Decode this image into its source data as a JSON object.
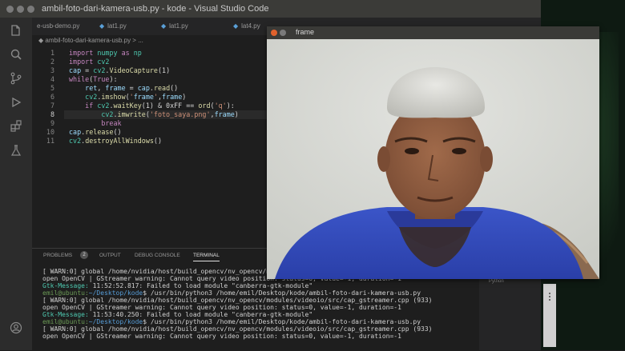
{
  "window": {
    "title": "ambil-foto-dari-kamera-usb.py - kode - Visual Studio Code"
  },
  "tabs": [
    {
      "label": "e-usb-demo.py"
    },
    {
      "label": "lat1.py"
    },
    {
      "label": "lat1.py"
    },
    {
      "label": "lat4.py"
    }
  ],
  "breadcrumb": "◆ ambil-foto-dari-kamera-usb.py > ...",
  "code": {
    "current_line": 8,
    "lines": [
      {
        "n": "1",
        "text": "import numpy as np"
      },
      {
        "n": "2",
        "text": "import cv2"
      },
      {
        "n": "3",
        "text": "cap = cv2.VideoCapture(1)"
      },
      {
        "n": "4",
        "text": "while(True):"
      },
      {
        "n": "5",
        "text": "    ret, frame = cap.read()"
      },
      {
        "n": "6",
        "text": "    cv2.imshow('frame',frame)"
      },
      {
        "n": "7",
        "text": "    if cv2.waitKey(1) & 0xFF == ord('q'):"
      },
      {
        "n": "8",
        "text": "        cv2.imwrite('foto_saya.png',frame)"
      },
      {
        "n": "9",
        "text": "        break"
      },
      {
        "n": "10",
        "text": "cap.release()"
      },
      {
        "n": "11",
        "text": "cv2.destroyAllWindows()"
      }
    ]
  },
  "panel": {
    "tabs": [
      {
        "label": "PROBLEMS"
      },
      {
        "label": "OUTPUT"
      },
      {
        "label": "DEBUG CONSOLE"
      },
      {
        "label": "TERMINAL"
      }
    ],
    "problems_count": "2",
    "terminal": [
      {
        "text": "[ WARN:0] global /home/nvidia/host/build_opencv/nv_opencv/modules/videoio/src/cap_gstreamer.cpp (933)",
        "color": "#d0d0d0"
      },
      {
        "text": "open OpenCV | GStreamer warning: Cannot query video position: status=0, value=-1, duration=-1",
        "color": "#d0d0d0"
      },
      {
        "text": "Gtk-Message: 11:52:52.817: Failed to load module \"canberra-gtk-module\"",
        "color": "#d0d0d0"
      },
      {
        "text": "emil@ubuntu:~/Desktop/kode$ /usr/bin/python3 /home/emil/Desktop/kode/ambil-foto-dari-kamera-usb.py",
        "color": "#d0d0d0"
      },
      {
        "text": "[ WARN:0] global /home/nvidia/host/build_opencv/nv_opencv/modules/videoio/src/cap_gstreamer.cpp (933)",
        "color": "#d0d0d0"
      },
      {
        "text": "open OpenCV | GStreamer warning: Cannot query video position: status=0, value=-1, duration=-1",
        "color": "#d0d0d0"
      },
      {
        "text": "Gtk-Message: 11:53:40.250: Failed to load module \"canberra-gtk-module\"",
        "color": "#d0d0d0"
      },
      {
        "text": "emil@ubuntu:~/Desktop/kode$ /usr/bin/python3 /home/emil/Desktop/kode/ambil-foto-dari-kamera-usb.py",
        "color": "#d0d0d0"
      },
      {
        "text": "[ WARN:0] global /home/nvidia/host/build_opencv/nv_opencv/modules/videoio/src/cap_gstreamer.cpp (933)",
        "color": "#d0d0d0"
      },
      {
        "text": "open OpenCV | GStreamer warning: Cannot query video position: status=0, value=-1, duration=-1",
        "color": "#d0d0d0"
      }
    ]
  },
  "frame_window": {
    "title": "frame"
  },
  "side_panel": {
    "label": "Python"
  },
  "icons": {
    "activity_bar": [
      "files-icon",
      "search-icon",
      "source-control-icon",
      "run-debug-icon",
      "extensions-icon",
      "test-flask-icon"
    ],
    "bottom": "account-icon"
  },
  "colors": {
    "keyword": "#c586c0",
    "module": "#4ec9b0",
    "string": "#ce9178",
    "variable": "#9cdcfe",
    "function": "#dcdcaa",
    "user_prompt": "#6a9955",
    "path_prompt": "#569cd6",
    "gtk_label": "#4ec9b0",
    "accent_tab": "#5aa0d8"
  }
}
